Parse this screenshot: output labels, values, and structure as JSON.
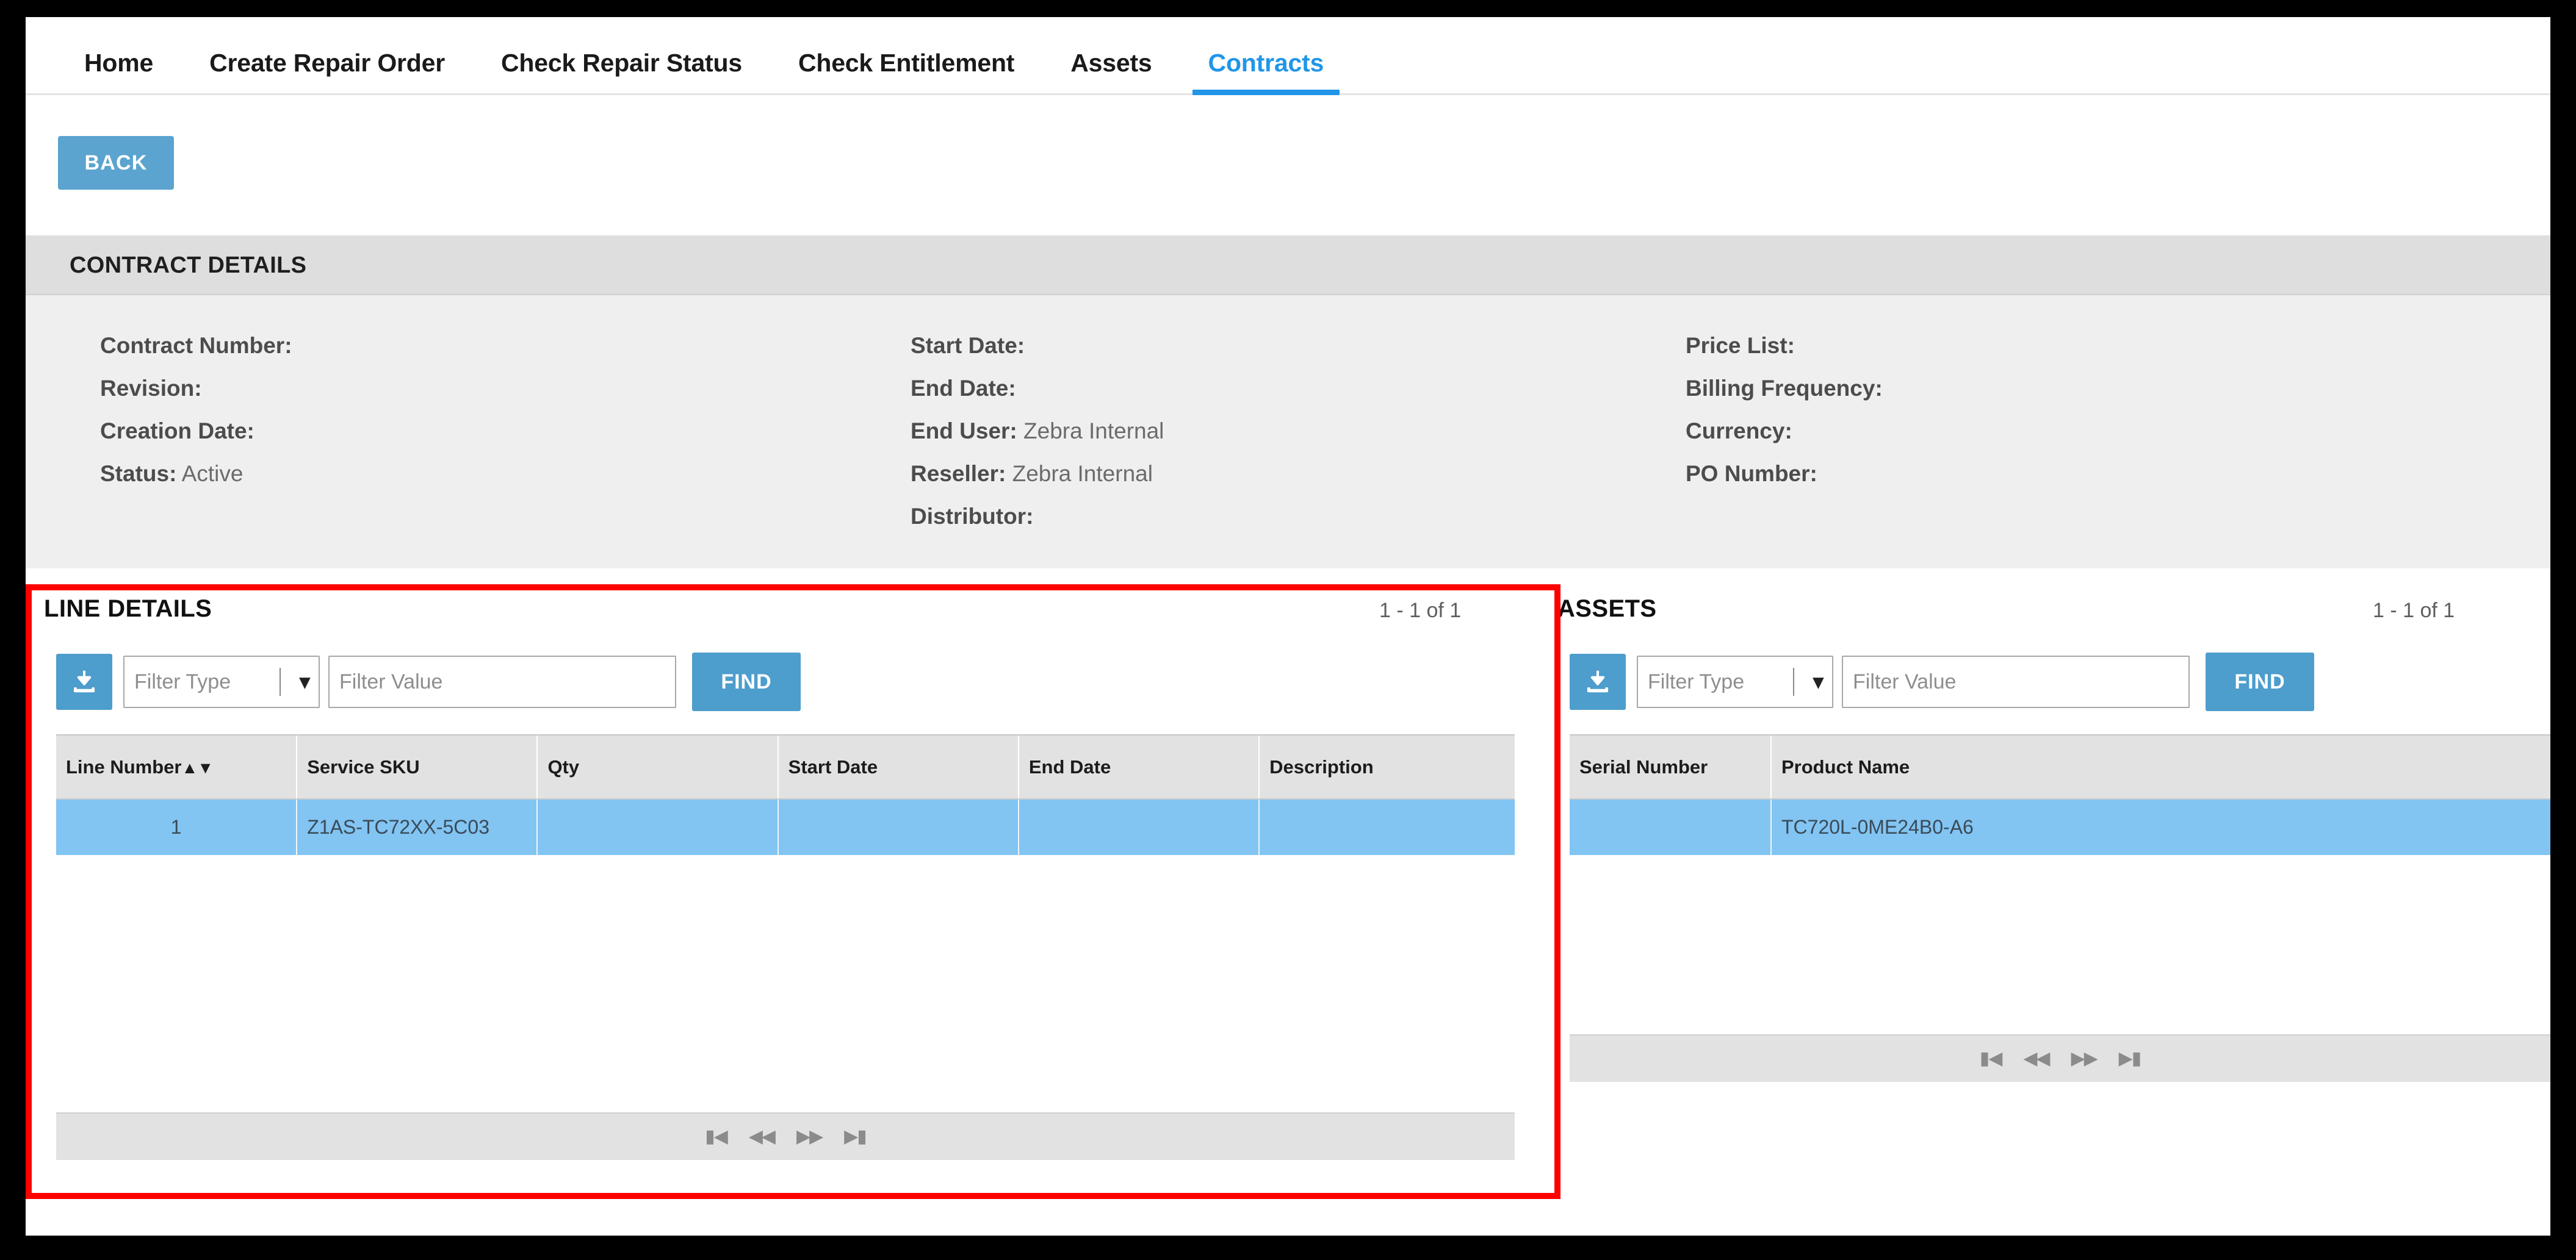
{
  "nav": {
    "items": [
      {
        "label": "Home",
        "active": false
      },
      {
        "label": "Create Repair Order",
        "active": false
      },
      {
        "label": "Check Repair Status",
        "active": false
      },
      {
        "label": "Check Entitlement",
        "active": false
      },
      {
        "label": "Assets",
        "active": false
      },
      {
        "label": "Contracts",
        "active": true
      }
    ]
  },
  "toolbar": {
    "back_label": "BACK"
  },
  "contract_details": {
    "header_title": "CONTRACT DETAILS",
    "columns": [
      [
        {
          "label": "Contract Number:",
          "value": ""
        },
        {
          "label": "Revision:",
          "value": ""
        },
        {
          "label": "Creation Date:",
          "value": ""
        },
        {
          "label": "Status:",
          "value": "Active"
        }
      ],
      [
        {
          "label": "Start Date:",
          "value": ""
        },
        {
          "label": "End Date:",
          "value": ""
        },
        {
          "label": "End User:",
          "value": "Zebra Internal"
        },
        {
          "label": "Reseller:",
          "value": "Zebra Internal"
        },
        {
          "label": "Distributor:",
          "value": ""
        }
      ],
      [
        {
          "label": "Price List:",
          "value": ""
        },
        {
          "label": "Billing Frequency:",
          "value": ""
        },
        {
          "label": "Currency:",
          "value": ""
        },
        {
          "label": "PO Number:",
          "value": ""
        }
      ]
    ]
  },
  "line_details": {
    "title": "LINE DETAILS",
    "count": "1 - 1 of 1",
    "download_icon": "download-icon",
    "filter_type_value": "Filter Type",
    "filter_value_placeholder": "Filter Value",
    "find_label": "FIND",
    "headers": [
      "Line Number",
      "Service SKU",
      "Qty",
      "Start Date",
      "End Date",
      "Description"
    ],
    "sort_column": "Line Number",
    "sort_glyphs": "▲▼",
    "rows": [
      {
        "line_number": "1",
        "service_sku": "Z1AS-TC72XX-5C03",
        "qty": "",
        "start_date": "",
        "end_date": "",
        "description": "",
        "selected": true
      }
    ],
    "pagination": [
      {
        "icon": "first-page-icon",
        "glyph": "⏮"
      },
      {
        "icon": "prev-page-icon",
        "glyph": "⏪"
      },
      {
        "icon": "next-page-icon",
        "glyph": "⏩"
      },
      {
        "icon": "last-page-icon",
        "glyph": "⏭"
      }
    ]
  },
  "assets": {
    "title": "ASSETS",
    "count": "1 - 1 of 1",
    "download_icon": "download-icon",
    "filter_type_value": "Filter Type",
    "filter_value_placeholder": "Filter Value",
    "find_label": "FIND",
    "headers": [
      "Serial Number",
      "Product Name"
    ],
    "rows": [
      {
        "serial_number": "",
        "product_name": "TC720L-0ME24B0-A6",
        "selected": true
      }
    ],
    "pagination": [
      {
        "icon": "first-page-icon",
        "glyph": "⏮"
      },
      {
        "icon": "prev-page-icon",
        "glyph": "⏪"
      },
      {
        "icon": "next-page-icon",
        "glyph": "⏩"
      },
      {
        "icon": "last-page-icon",
        "glyph": "⏭"
      }
    ]
  },
  "annotation": {
    "type": "red-highlight-box",
    "color": "#ff0000",
    "target": "line-details-panel"
  },
  "colors": {
    "accent_blue": "#4d9dcd",
    "active_tab": "#2196e8",
    "selected_row": "#82c4f2",
    "header_gray": "#dedede",
    "panel_gray": "#efefef",
    "annotation_red": "#ff0000"
  }
}
